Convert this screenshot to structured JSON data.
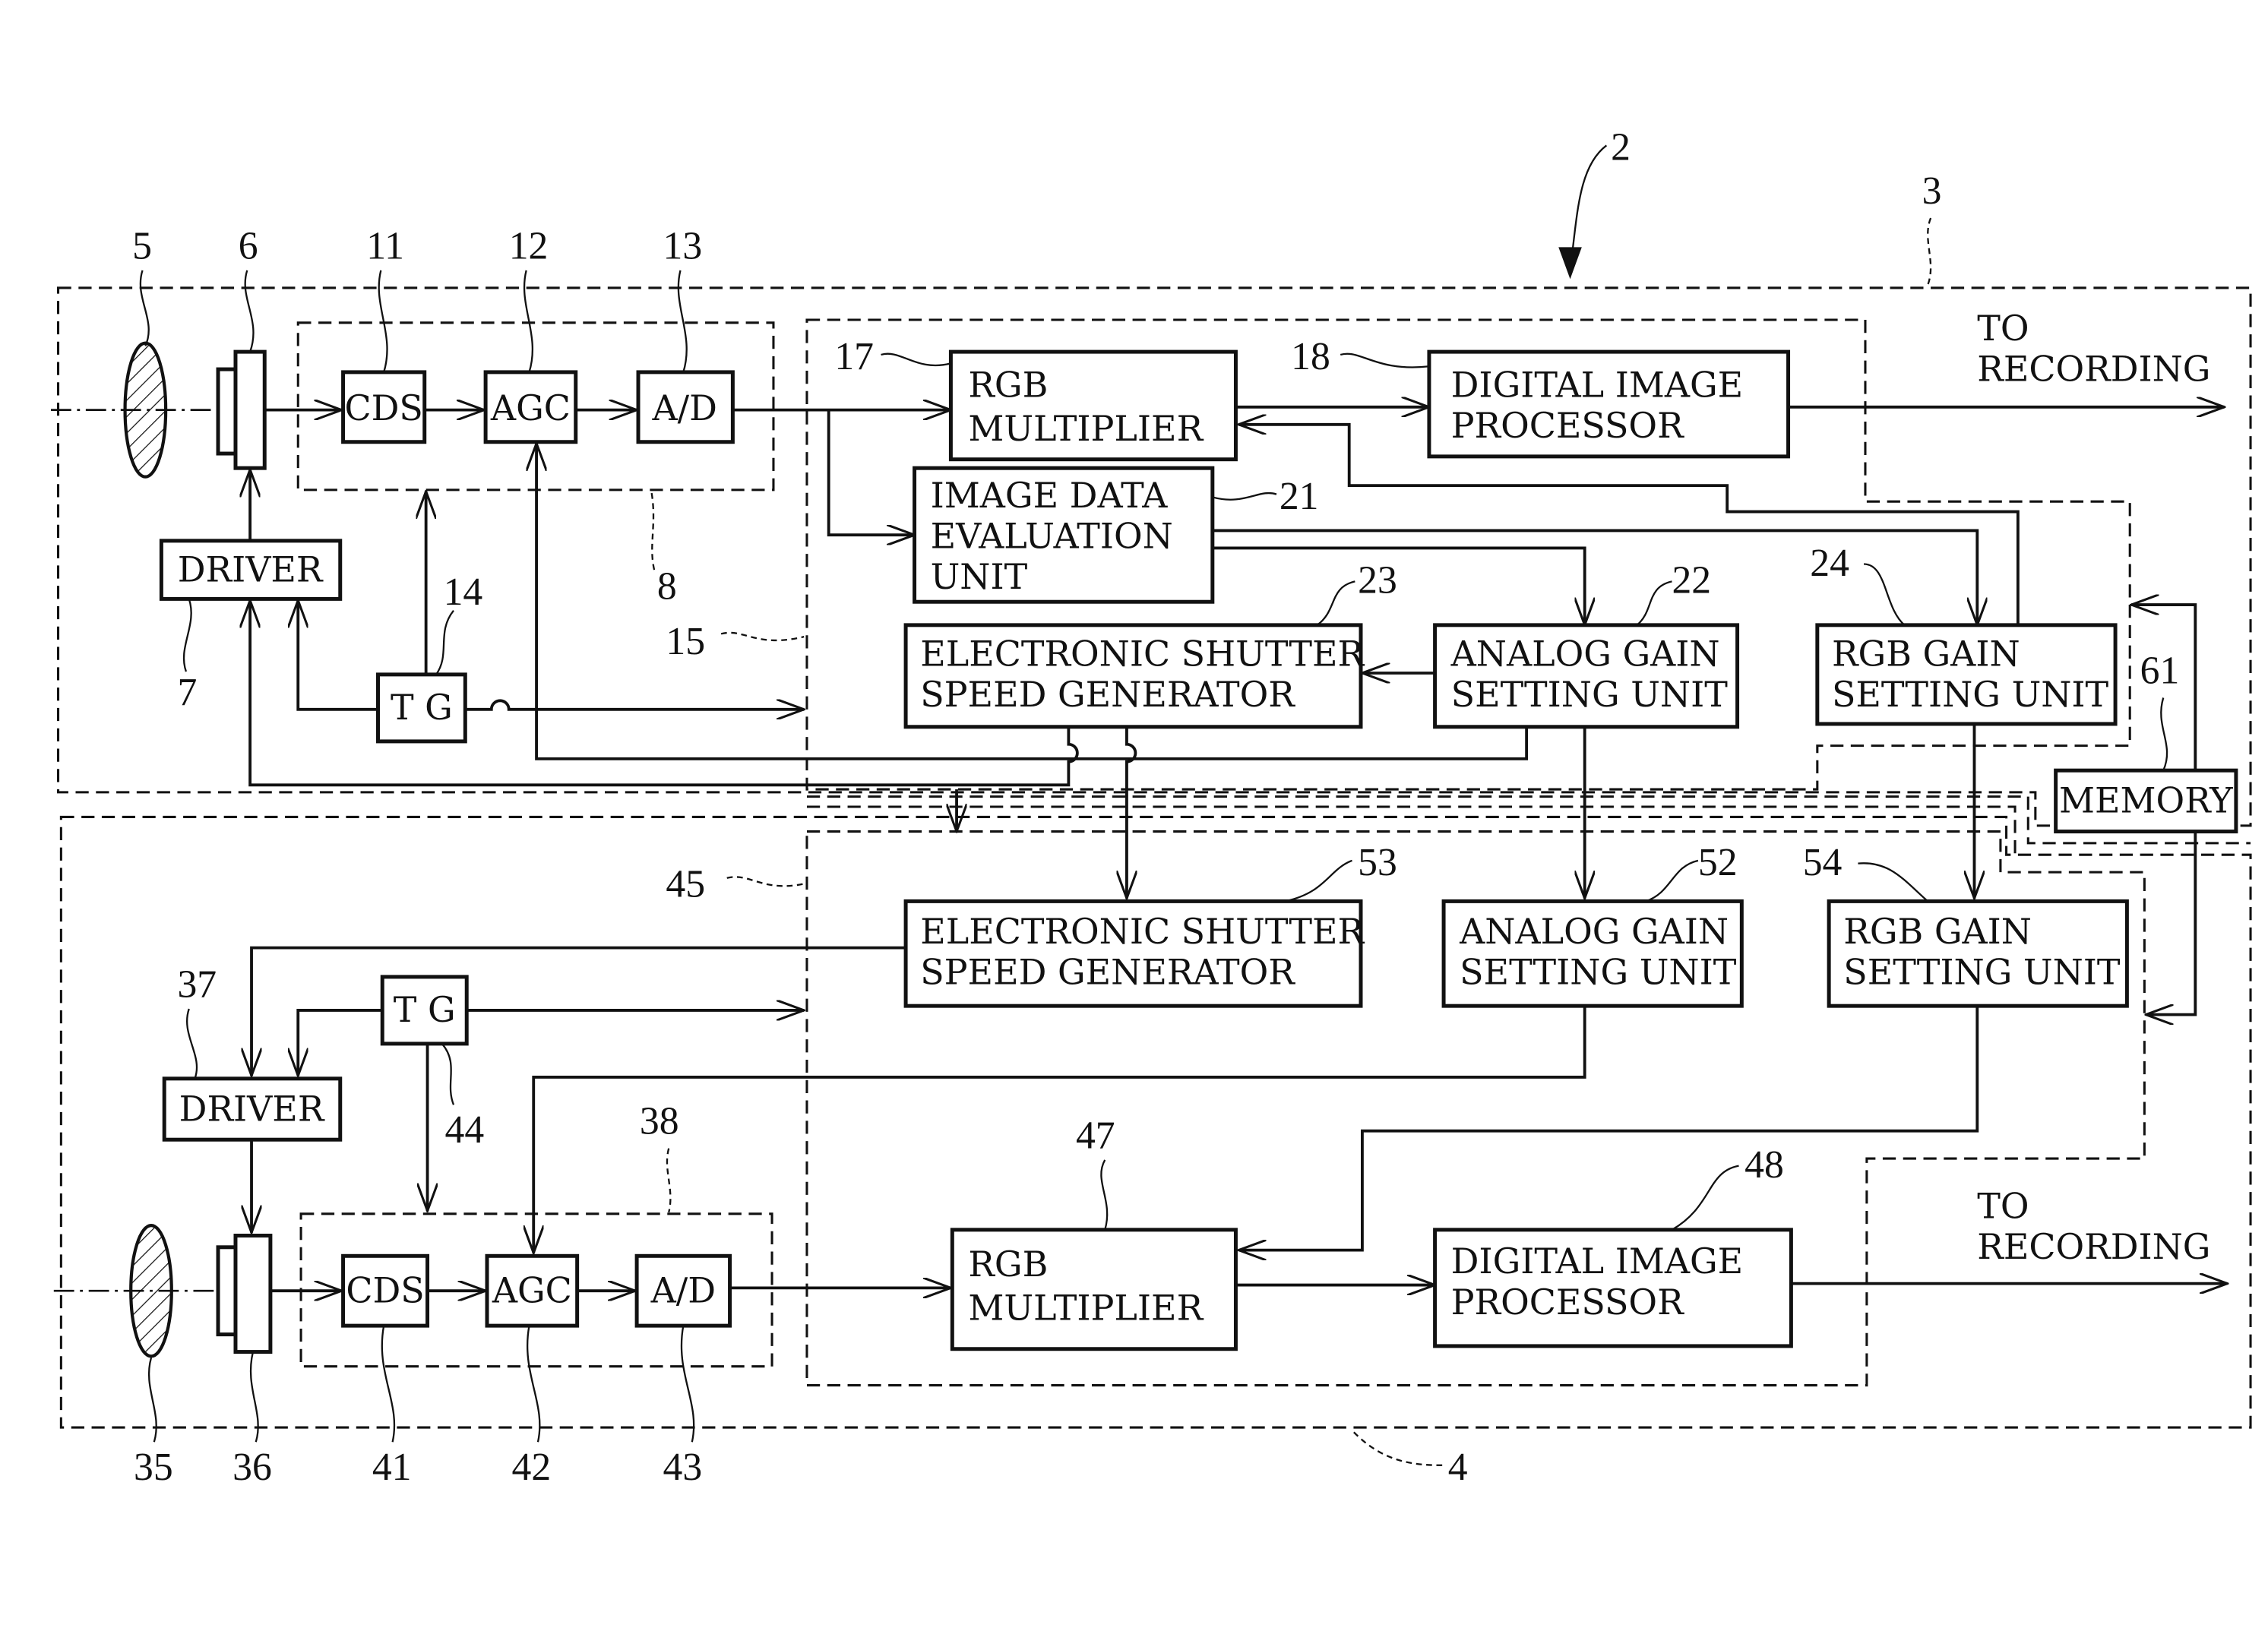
{
  "figure": {
    "refs": {
      "device": "2",
      "camera_top": "3",
      "camera_bottom": "4",
      "lens_top": "5",
      "sensor_top": "6",
      "driver_top": "7",
      "afe_top": "8",
      "cds_top": "11",
      "agc_top": "12",
      "ad_top": "13",
      "tg_top": "14",
      "proc_top": "15",
      "rgb_mult_top": "17",
      "dip_top": "18",
      "eval": "21",
      "agsu_top": "22",
      "essg_top": "23",
      "rgbgsu_top": "24",
      "lens_bot": "35",
      "sensor_bot": "36",
      "driver_bot": "37",
      "afe_bot": "38",
      "cds_bot": "41",
      "agc_bot": "42",
      "ad_bot": "43",
      "tg_bot": "44",
      "proc_bot": "45",
      "rgb_mult_bot": "47",
      "dip_bot": "48",
      "agsu_bot": "52",
      "essg_bot": "53",
      "rgbgsu_bot": "54",
      "memory": "61"
    },
    "blocks": {
      "cds": "CDS",
      "agc": "AGC",
      "ad": "A/D",
      "driver": "DRIVER",
      "tg": "T G",
      "rgb_mult_l1": "RGB",
      "rgb_mult_l2": "MULTIPLIER",
      "dip_l1": "DIGITAL IMAGE",
      "dip_l2": "PROCESSOR",
      "eval_l1": "IMAGE DATA",
      "eval_l2": "EVALUATION",
      "eval_l3": "UNIT",
      "essg_l1": "ELECTRONIC SHUTTER",
      "essg_l2": "SPEED GENERATOR",
      "agsu_l1": "ANALOG GAIN",
      "agsu_l2": "SETTING UNIT",
      "rgbgsu_l1": "RGB GAIN",
      "rgbgsu_l2": "SETTING UNIT",
      "memory": "MEMORY"
    },
    "outputs": {
      "to": "TO",
      "recording": "RECORDING"
    }
  }
}
